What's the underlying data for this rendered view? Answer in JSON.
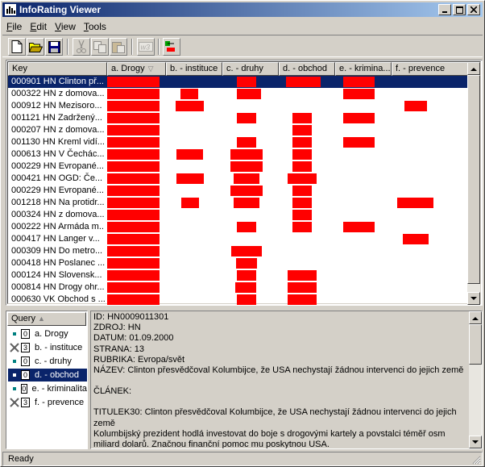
{
  "window": {
    "title": "InfoRating Viewer"
  },
  "menu": [
    {
      "label": "File",
      "u": "F",
      "rest": "ile"
    },
    {
      "label": "Edit",
      "u": "E",
      "rest": "dit"
    },
    {
      "label": "View",
      "u": "V",
      "rest": "iew"
    },
    {
      "label": "Tools",
      "u": "T",
      "rest": "ools"
    }
  ],
  "toolbar": {
    "icons": [
      "new-document-icon",
      "open-folder-icon",
      "save-icon",
      "cut-icon",
      "copy-icon",
      "paste-icon",
      "w3-icon",
      "rating-icon"
    ]
  },
  "grid": {
    "columns": [
      {
        "label": "Key"
      },
      {
        "label": "a. Drogy",
        "sorted": true
      },
      {
        "label": "b. - instituce"
      },
      {
        "label": "c. - druhy"
      },
      {
        "label": "d. - obchod"
      },
      {
        "label": "e. - krimina..."
      },
      {
        "label": "f. - prevence"
      }
    ],
    "rows": [
      {
        "key": "000901 HN Clinton př...",
        "selected": true
      },
      {
        "key": "000322 HN z domova..."
      },
      {
        "key": "000912 HN Mezisoro..."
      },
      {
        "key": "001121 HN Zadržený..."
      },
      {
        "key": "000207 HN z domova..."
      },
      {
        "key": "001130 HN Kreml vidí..."
      },
      {
        "key": "000613 HN V Čechác..."
      },
      {
        "key": "000229 HN Evropané..."
      },
      {
        "key": "000421 HN OGD: Če..."
      },
      {
        "key": "000229 HN Evropané..."
      },
      {
        "key": "001218 HN Na protidr..."
      },
      {
        "key": "000324 HN z domova..."
      },
      {
        "key": "000222 HN Armáda m..."
      },
      {
        "key": "000417 HN Langer v..."
      },
      {
        "key": "000309 HN Do metro..."
      },
      {
        "key": "000418 HN Poslanec ..."
      },
      {
        "key": "000124 HN Slovensk..."
      },
      {
        "key": "000814 HN Drogy ohr..."
      },
      {
        "key": "000630 VK Obchod s ..."
      }
    ],
    "accent": "#ff0000",
    "selection": "#0a246a"
  },
  "query": {
    "header": "Query",
    "items": [
      {
        "mark": "dot",
        "count": "0",
        "label": "a. Drogy"
      },
      {
        "mark": "x",
        "count": "3",
        "label": "b. - instituce"
      },
      {
        "mark": "dot",
        "count": "0",
        "label": "c. - druhy"
      },
      {
        "mark": "dot",
        "count": "0",
        "label": "d. - obchod",
        "selected": true
      },
      {
        "mark": "dot",
        "count": "0",
        "label": "e. - kriminalita"
      },
      {
        "mark": "x",
        "count": "3",
        "label": "f. - prevence"
      }
    ]
  },
  "detail": {
    "lines": [
      "ID: HN0009011301",
      "ZDROJ: HN",
      "DATUM: 01.09.2000",
      "STRANA: 13",
      "RUBRIKA: Evropa/svět",
      "NÁZEV: Clinton přesvědčoval Kolumbijce, že USA nechystají žádnou intervenci do jejich země",
      "",
      "ČLÁNEK:",
      "",
      "TITULEK30: Clinton přesvědčoval Kolumbijce, že USA nechystají žádnou intervenci do jejich země",
      "Kolumbijský prezident hodlá investovat do boje s drogovými kartely a povstalci téměř osm miliard dolarů. Značnou finanční pomoc mu poskytnou USA."
    ]
  },
  "status": {
    "text": "Ready"
  }
}
